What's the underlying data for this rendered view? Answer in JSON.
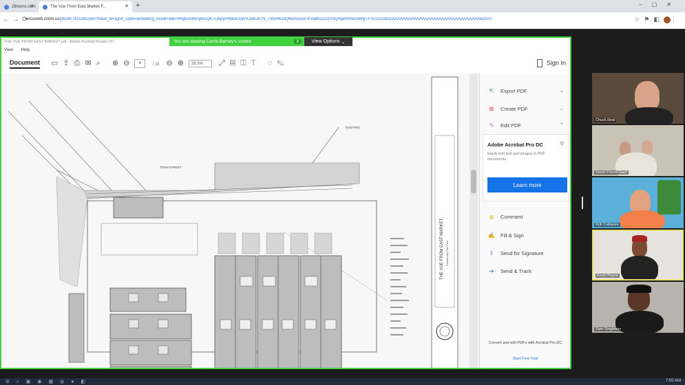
{
  "browser": {
    "tabs": [
      {
        "label": "Zillowns.com"
      },
      {
        "label": "The Vue From East Market F..."
      }
    ],
    "new_tab": "+",
    "url_host": "us02web.zoom.us",
    "url_rest": "/j/82407415281/join?track_id=&jmf_code=&meeting_result=&tk=PfIg9ZeWPyBGQK7UApyPNdu8-l3jVXJuBJ8TN_TWoHEOQNAAAAATKVa8fl2ZOzV0QmpiRVNOoWtyTFVcU2Zsb32xAAAAAAAAAAAAAAAAAAAAAAAAAAAAAAA&zc=0"
  },
  "zoom": {
    "sharing_banner": "You are viewing Carrie Barney's screen",
    "sharing_pill": "Ⅱ",
    "view_options": "View Options"
  },
  "acrobat": {
    "title": "THE VUE FROM EAST MARKET.pdf - Adobe Acrobat Reader DC",
    "menu": [
      "View",
      "Help"
    ],
    "document_tab": "Document",
    "page_current": "4",
    "page_total": "/ 18",
    "zoom_level": "28.9%",
    "sign_in": "Sign In",
    "panel": {
      "export_pdf": "Export PDF",
      "create_pdf": "Create PDF",
      "edit_pdf": "Edit PDF",
      "promo_title": "Adobe Acrobat Pro DC",
      "promo_desc": "Easily edit text and images in PDF documents.",
      "learn_more": "Learn more",
      "comment": "Comment",
      "fill_sign": "Fill & Sign",
      "send_signature": "Send for Signature",
      "send_track": "Send & Track",
      "footer_text": "Convert and edit PDFs with Acrobat Pro DC",
      "free_trial": "Start Free Trial"
    },
    "drawing": {
      "title_block_name": "THE VUE FROM EAST MARKET",
      "title_block_sub": "Preliminary Site Plan",
      "street_label": "TITAN STREET",
      "callout": "EXISTING"
    }
  },
  "participants": [
    {
      "name": "Chuck Real"
    },
    {
      "name": "Sarah Friend Gard"
    },
    {
      "name": "Rob Cattaneo"
    },
    {
      "name": "Kevin Payne"
    },
    {
      "name": "Sam Singletary"
    }
  ],
  "taskbar": {
    "clock": "7:00 AM"
  }
}
